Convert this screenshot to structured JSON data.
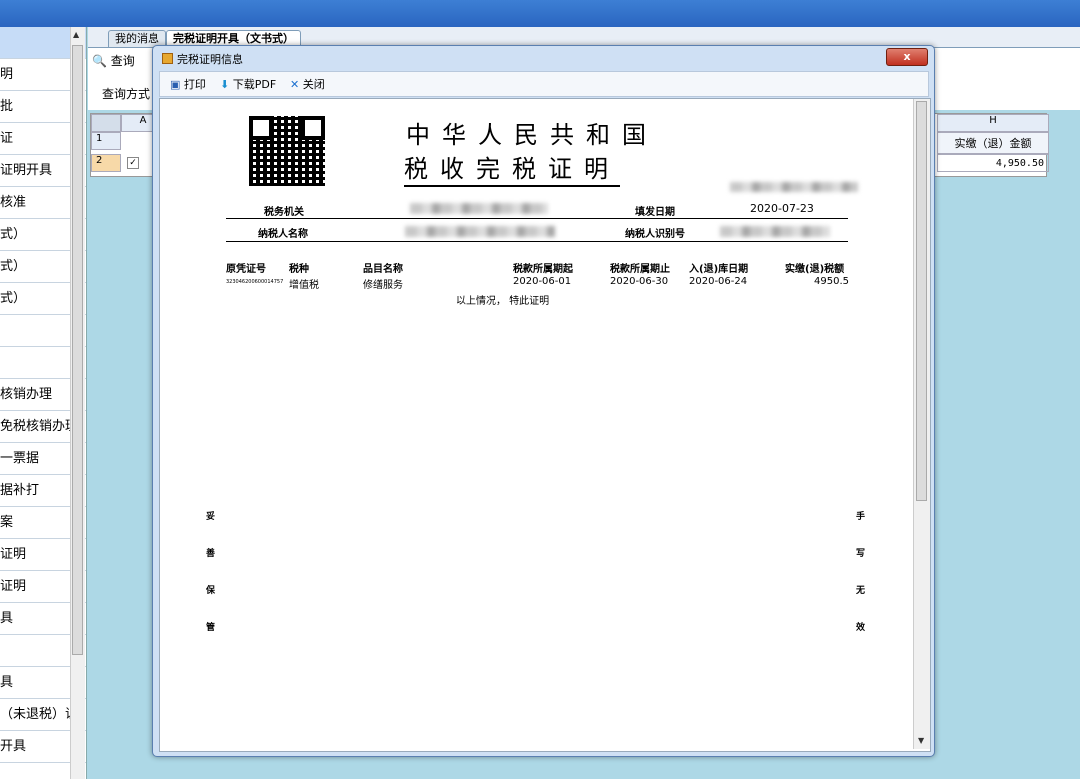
{
  "nav": {
    "items": [
      {
        "label": ""
      },
      {
        "label": "明"
      },
      {
        "label": "批"
      },
      {
        "label": "证"
      },
      {
        "label": "证明开具"
      },
      {
        "label": "核准"
      },
      {
        "label": "式）"
      },
      {
        "label": "式）"
      },
      {
        "label": "式）"
      },
      {
        "label": ""
      },
      {
        "label": ""
      },
      {
        "label": "核销办理"
      },
      {
        "label": "免税核销办理"
      },
      {
        "label": "一票据"
      },
      {
        "label": "据补打"
      },
      {
        "label": "案"
      },
      {
        "label": "证明"
      },
      {
        "label": "证明"
      },
      {
        "label": "具"
      },
      {
        "label": ""
      },
      {
        "label": "具"
      },
      {
        "label": "（未退税）证"
      },
      {
        "label": "开具"
      }
    ]
  },
  "tabs": [
    {
      "label": "我的消息"
    },
    {
      "label": "完税证明开具（文书式）"
    }
  ],
  "toolbar": {
    "query_label": "查询"
  },
  "query": {
    "method_label": "查询方式"
  },
  "grid": {
    "col_a": "A",
    "col_h": "H",
    "col_h_title": "实缴（退）金额",
    "rows": [
      {
        "num": "1"
      },
      {
        "num": "2"
      }
    ],
    "amount": "4,950.50"
  },
  "dialog": {
    "title": "完税证明信息",
    "close_label": "x",
    "print_label": "打印",
    "pdf_label": "下载PDF",
    "close_btn_label": "关闭"
  },
  "certificate": {
    "title1": "中华人民共和国",
    "title2": "税收完税证明",
    "tax_office_label": "税务机关",
    "issue_date_label": "填发日期",
    "issue_date": "2020-07-23",
    "taxpayer_name_label": "纳税人名称",
    "taxpayer_id_label": "纳税人识别号",
    "columns": [
      "原凭证号",
      "税种",
      "品目名称",
      "税款所属期起",
      "税款所属期止",
      "入(退)库日期",
      "实缴(退)税额"
    ],
    "row": {
      "voucher": "323046200600014757",
      "tax_type": "增值税",
      "item": "修缮服务",
      "period_start": "2020-06-01",
      "period_end": "2020-06-30",
      "date": "2020-06-24",
      "amount": "4950.5"
    },
    "note": "以上情况， 特此证明",
    "left_vertical": [
      "妥",
      "善",
      "保",
      "管"
    ],
    "right_vertical": [
      "手",
      "写",
      "无",
      "效"
    ]
  }
}
